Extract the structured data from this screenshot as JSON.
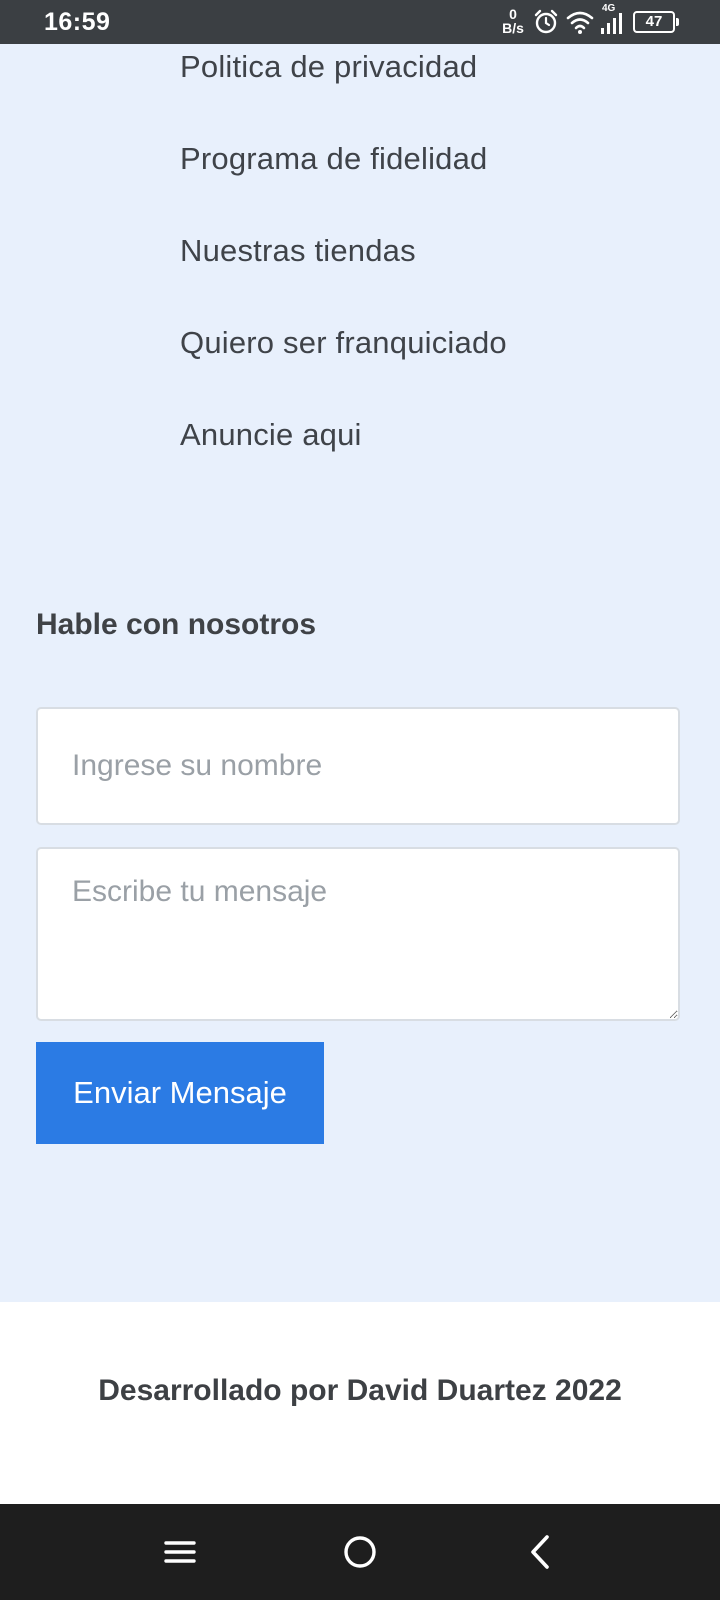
{
  "status_bar": {
    "time": "16:59",
    "net_speed_value": "0",
    "net_speed_unit": "B/s",
    "network_type": "4G",
    "battery_level": "47",
    "icons": [
      "alarm-icon",
      "wifi-icon",
      "signal-icon",
      "battery-icon"
    ]
  },
  "links": [
    "Politica de privacidad",
    "Programa de fidelidad",
    "Nuestras tiendas",
    "Quiero ser franquiciado",
    "Anuncie aqui"
  ],
  "contact": {
    "heading": "Hable con nosotros",
    "name_placeholder": "Ingrese su nombre",
    "message_placeholder": "Escribe tu mensaje",
    "send_label": "Enviar Mensaje"
  },
  "footer": {
    "credit": "Desarrollado por David Duartez 2022"
  },
  "nav_bar": {
    "buttons": [
      "menu-icon",
      "home-icon",
      "back-icon"
    ]
  },
  "colors": {
    "page_background": "#e8f0fc",
    "status_bar": "#3b3f43",
    "accent_button": "#2b7be4",
    "footer_background": "#ffffff",
    "nav_bar": "#1e1e1e"
  }
}
